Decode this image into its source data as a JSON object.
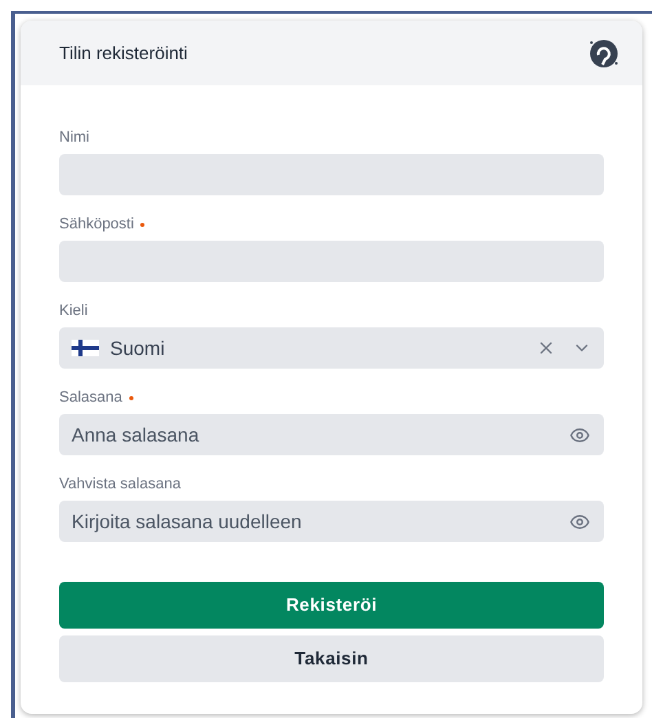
{
  "card": {
    "title": "Tilin rekisteröinti"
  },
  "fields": [
    {
      "kind": "text",
      "label": "Nimi",
      "required": false
    },
    {
      "kind": "text",
      "label": "Sähköposti",
      "required": true
    },
    {
      "kind": "select",
      "label": "Kieli",
      "required": false,
      "value": "Suomi"
    },
    {
      "kind": "password",
      "label": "Salasana",
      "required": true,
      "placeholder": "Anna salasana"
    },
    {
      "kind": "password",
      "label": "Vahvista salasana",
      "required": false,
      "placeholder": "Kirjoita salasana uudelleen"
    }
  ],
  "buttons": [
    {
      "label": "Rekisteröi",
      "primary": true
    },
    {
      "label": "Takaisin",
      "primary": false
    }
  ]
}
